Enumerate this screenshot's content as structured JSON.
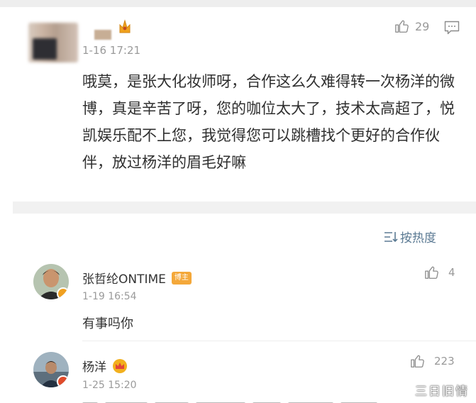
{
  "post": {
    "time": "1-16 17:21",
    "like_count": "29",
    "body": "哦莫，是张大化妆师呀，合作这么久难得转一次杨洋的微博，真是辛苦了呀，您的咖位太大了，技术太高超了，悦凯娱乐配不上您，我觉得您可以跳槽找个更好的合作伙伴，放过杨洋的眉毛好嘛"
  },
  "sort": {
    "label": "按热度",
    "icon": "sort-lines-icon"
  },
  "replies": [
    {
      "name": "张哲纶ONTIME",
      "tag": "博主",
      "time": "1-19 16:54",
      "text": "有事吗你",
      "like_count": "4"
    },
    {
      "name": "杨洋",
      "time": "1-25 15:20",
      "like_count": "223",
      "badge_icon": "crown-icon"
    }
  ],
  "watermark": "三日旧情",
  "colors": {
    "text": "#333333",
    "muted": "#9a9a9a",
    "link": "#5b7a93",
    "author_tag": "#f4a83a",
    "verified": "#f0a020",
    "crown": "#e8a51b"
  }
}
